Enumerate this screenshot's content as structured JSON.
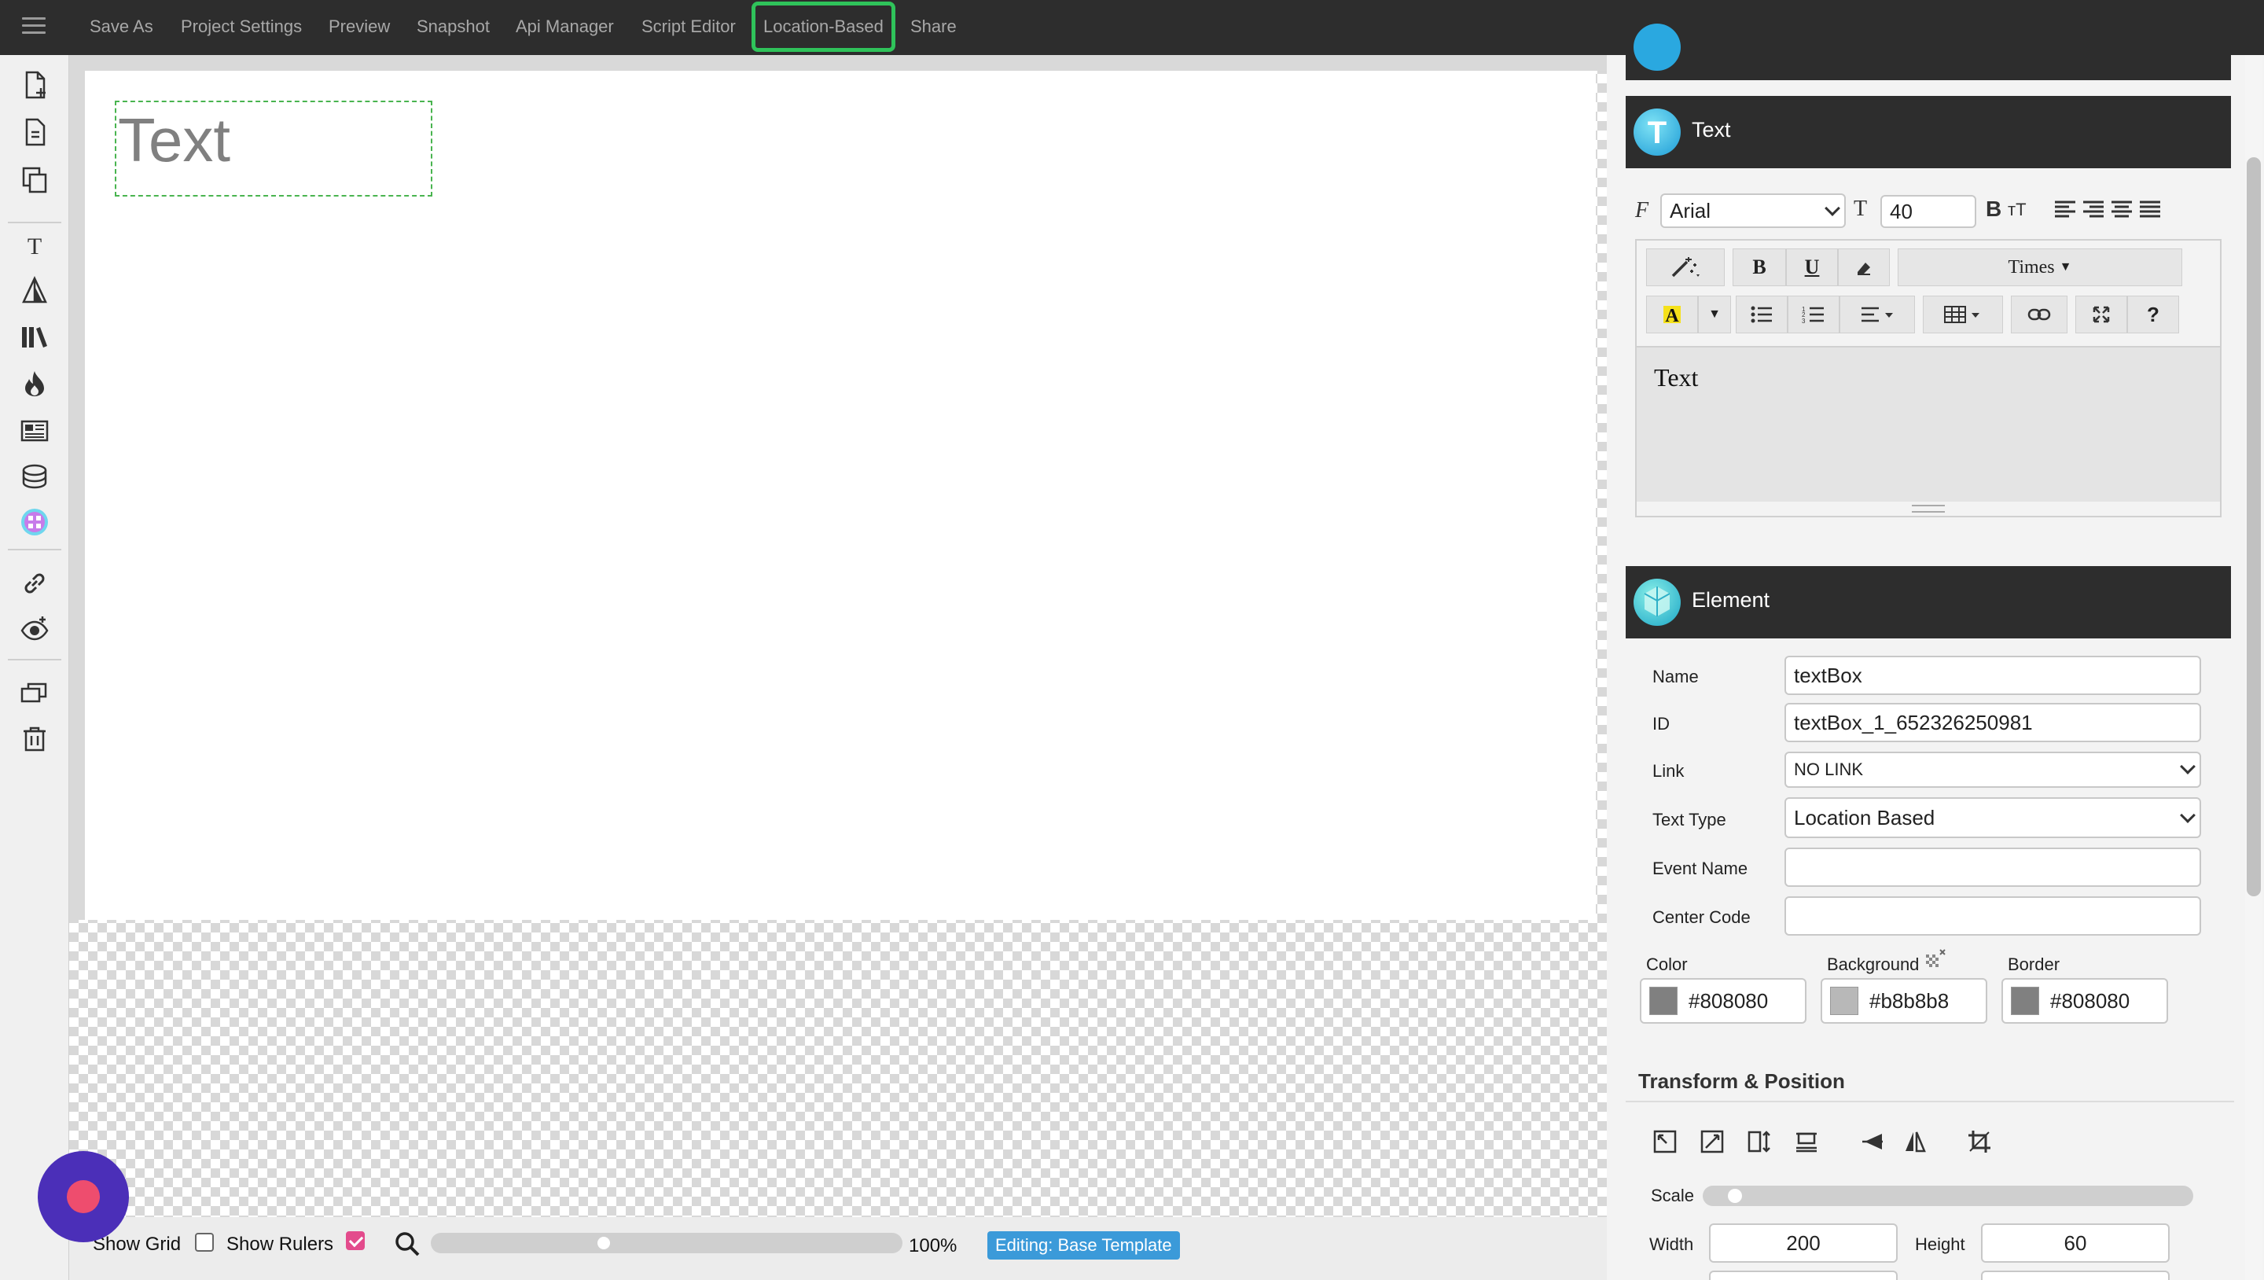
{
  "topbar": {
    "items": [
      {
        "label": "Save As"
      },
      {
        "label": "Project Settings"
      },
      {
        "label": "Preview"
      },
      {
        "label": "Snapshot"
      },
      {
        "label": "Api Manager"
      },
      {
        "label": "Script Editor"
      },
      {
        "label": "Location-Based",
        "active": true
      },
      {
        "label": "Share"
      }
    ]
  },
  "canvas": {
    "text_element": "Text"
  },
  "bottombar": {
    "show_grid_label": "Show Grid",
    "show_grid_checked": false,
    "show_rulers_label": "Show Rulers",
    "show_rulers_checked": true,
    "zoom_level": "100%",
    "zoom_fraction": 0.36,
    "editing_badge": "Editing: Base Template"
  },
  "text_panel": {
    "title": "Text",
    "font_family": "Arial",
    "font_size": "40",
    "font_name_dropdown": "Times",
    "content": "Text"
  },
  "element_panel": {
    "title": "Element",
    "name_label": "Name",
    "name_value": "textBox",
    "id_label": "ID",
    "id_value": "textBox_1_652326250981",
    "link_label": "Link",
    "link_value": "NO LINK",
    "text_type_label": "Text Type",
    "text_type_value": "Location Based",
    "event_name_label": "Event Name",
    "event_name_value": "",
    "center_code_label": "Center Code",
    "center_code_value": "",
    "color_label": "Color",
    "color_value": "#808080",
    "background_label": "Background",
    "background_value": "#b8b8b8",
    "border_label": "Border",
    "border_value": "#808080"
  },
  "transform_panel": {
    "title": "Transform & Position",
    "scale_label": "Scale",
    "width_label": "Width",
    "width_value": "200",
    "height_label": "Height",
    "height_value": "60"
  },
  "colors": {
    "accent_green": "#2fc35a",
    "badge_blue": "#3b9ad9",
    "record_purple": "#4b2fb8",
    "record_red": "#ee4d6e",
    "rulers_check": "#e34b8c"
  }
}
